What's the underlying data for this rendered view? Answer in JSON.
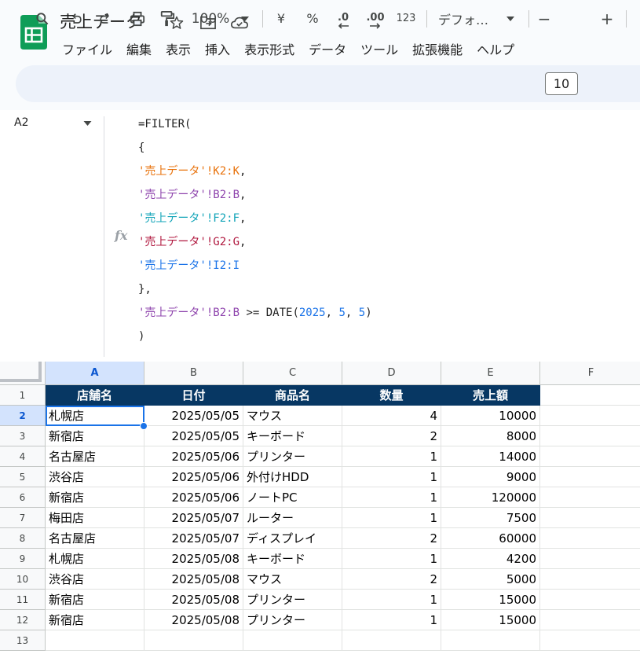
{
  "app": {
    "doc_title": "売上データ"
  },
  "menus": [
    "ファイル",
    "編集",
    "表示",
    "挿入",
    "表示形式",
    "データ",
    "ツール",
    "拡張機能",
    "ヘルプ"
  ],
  "toolbar": {
    "zoom": "100%",
    "currency_symbol": "¥",
    "percent_symbol": "%",
    "decrease_decimals": ".0",
    "increase_decimals": ".00",
    "more_formats": "123",
    "font": "デフォ…",
    "font_size": "10",
    "minus": "−",
    "plus": "+"
  },
  "namebox": "A2",
  "formula_lines": [
    {
      "text": "=FILTER(",
      "color": "#1f1f1f"
    },
    {
      "text": "{",
      "color": "#1f1f1f"
    },
    {
      "text": "'売上データ'!K2:K",
      "suffix": ",",
      "color": "#e8710a"
    },
    {
      "text": "'売上データ'!B2:B",
      "suffix": ",",
      "color": "#8e44ad"
    },
    {
      "text": "'売上データ'!F2:F",
      "suffix": ",",
      "color": "#12a4b8"
    },
    {
      "text": "'売上データ'!G2:G",
      "suffix": ",",
      "color": "#b0173e"
    },
    {
      "text": "'売上データ'!I2:I",
      "suffix": "",
      "color": "#1a73e8"
    },
    {
      "text": "},",
      "color": "#1f1f1f"
    },
    {
      "text": "'売上データ'!B2:B",
      "color": "#8e44ad",
      "rest": " >= DATE(",
      "args": [
        "2025",
        "5",
        "5"
      ],
      "close": ")"
    },
    {
      "text": ")",
      "color": "#1f1f1f"
    }
  ],
  "columns": [
    "A",
    "B",
    "C",
    "D",
    "E",
    "F"
  ],
  "rows": [
    "1",
    "2",
    "3",
    "4",
    "5",
    "6",
    "7",
    "8",
    "9",
    "10",
    "11",
    "12",
    "13"
  ],
  "table": {
    "headers": [
      "店舗名",
      "日付",
      "商品名",
      "数量",
      "売上額"
    ],
    "rows": [
      [
        "札幌店",
        "2025/05/05",
        "マウス",
        "4",
        "10000"
      ],
      [
        "新宿店",
        "2025/05/05",
        "キーボード",
        "2",
        "8000"
      ],
      [
        "名古屋店",
        "2025/05/06",
        "プリンター",
        "1",
        "14000"
      ],
      [
        "渋谷店",
        "2025/05/06",
        "外付けHDD",
        "1",
        "9000"
      ],
      [
        "新宿店",
        "2025/05/06",
        "ノートPC",
        "1",
        "120000"
      ],
      [
        "梅田店",
        "2025/05/07",
        "ルーター",
        "1",
        "7500"
      ],
      [
        "名古屋店",
        "2025/05/07",
        "ディスプレイ",
        "2",
        "60000"
      ],
      [
        "札幌店",
        "2025/05/08",
        "キーボード",
        "1",
        "4200"
      ],
      [
        "渋谷店",
        "2025/05/08",
        "マウス",
        "2",
        "5000"
      ],
      [
        "新宿店",
        "2025/05/08",
        "プリンター",
        "1",
        "15000"
      ],
      [
        "新宿店",
        "2025/05/08",
        "プリンター",
        "1",
        "15000"
      ]
    ]
  },
  "colors": {
    "header_fill": "#073763",
    "selection": "#1a73e8",
    "number_literal": "#1a73e8",
    "logo": "#0f9d58"
  }
}
